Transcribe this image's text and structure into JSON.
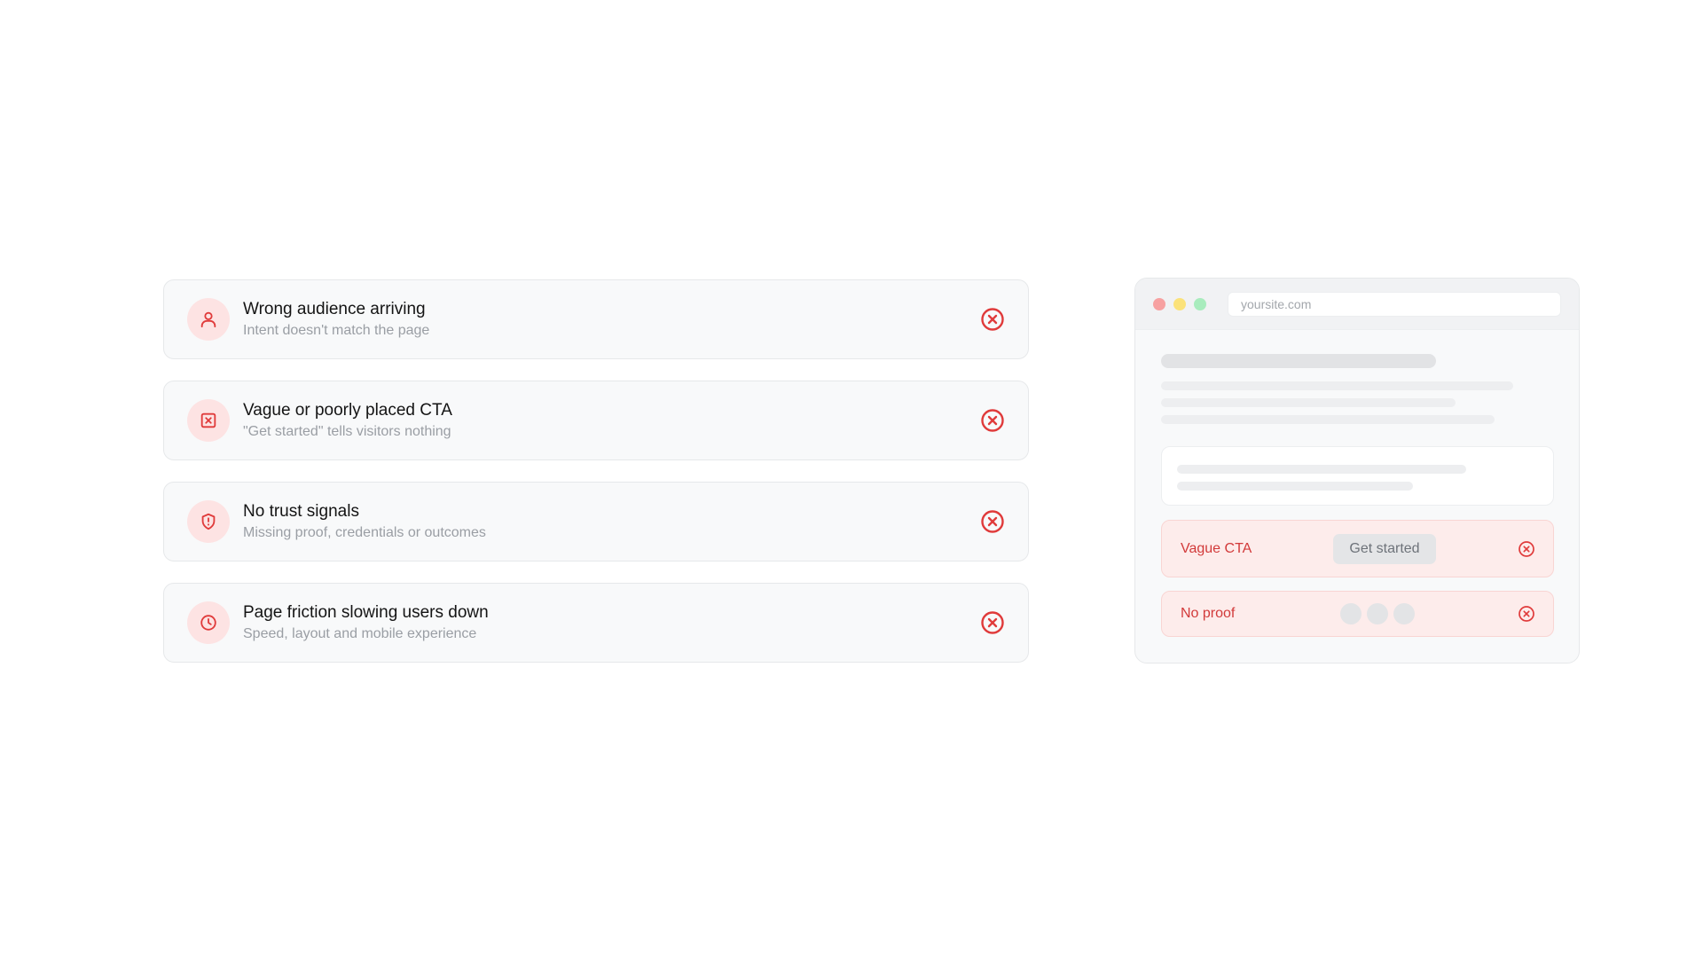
{
  "issues": [
    {
      "title": "Wrong audience arriving",
      "subtitle": "Intent doesn't match the page",
      "icon": "user-icon"
    },
    {
      "title": "Vague or poorly placed CTA",
      "subtitle": "\"Get started\" tells visitors nothing",
      "icon": "x-square-icon"
    },
    {
      "title": "No trust signals",
      "subtitle": "Missing proof, credentials or outcomes",
      "icon": "shield-alert-icon"
    },
    {
      "title": "Page friction slowing users down",
      "subtitle": "Speed, layout and mobile experience",
      "icon": "clock-icon"
    }
  ],
  "browser": {
    "url": "yoursite.com",
    "flags": {
      "cta_label": "Vague CTA",
      "cta_button": "Get started",
      "proof_label": "No proof"
    }
  },
  "colors": {
    "accent_red": "#e03b3b",
    "icon_bg": "#fde3e3",
    "flag_bg": "#fdeceb"
  }
}
